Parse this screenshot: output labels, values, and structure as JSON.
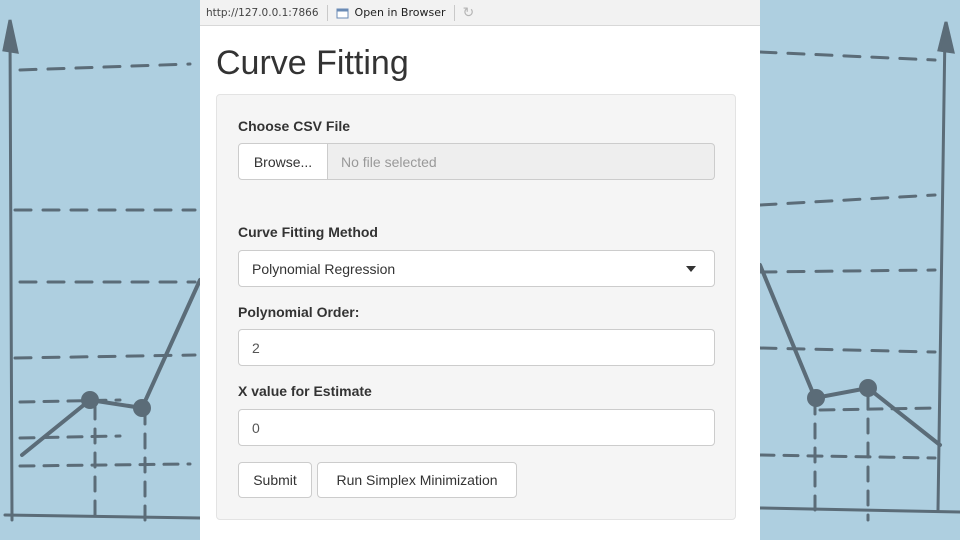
{
  "browser": {
    "url": "http://127.0.0.1:7866",
    "open_label": "Open in Browser",
    "open_icon": "external-window-icon",
    "refresh_icon": "refresh-icon"
  },
  "page": {
    "title": "Curve Fitting"
  },
  "form": {
    "file": {
      "label": "Choose CSV File",
      "browse_label": "Browse...",
      "status": "No file selected"
    },
    "method": {
      "label": "Curve Fitting Method",
      "selected": "Polynomial Regression"
    },
    "order": {
      "label": "Polynomial Order:",
      "value": "2"
    },
    "estimate": {
      "label": "X value for Estimate",
      "value": "0"
    },
    "buttons": {
      "submit": "Submit",
      "simplex": "Run Simplex Minimization"
    }
  },
  "colors": {
    "background": "#aecfe0",
    "sketch": "#5b6c78",
    "panel": "#f5f5f5"
  }
}
